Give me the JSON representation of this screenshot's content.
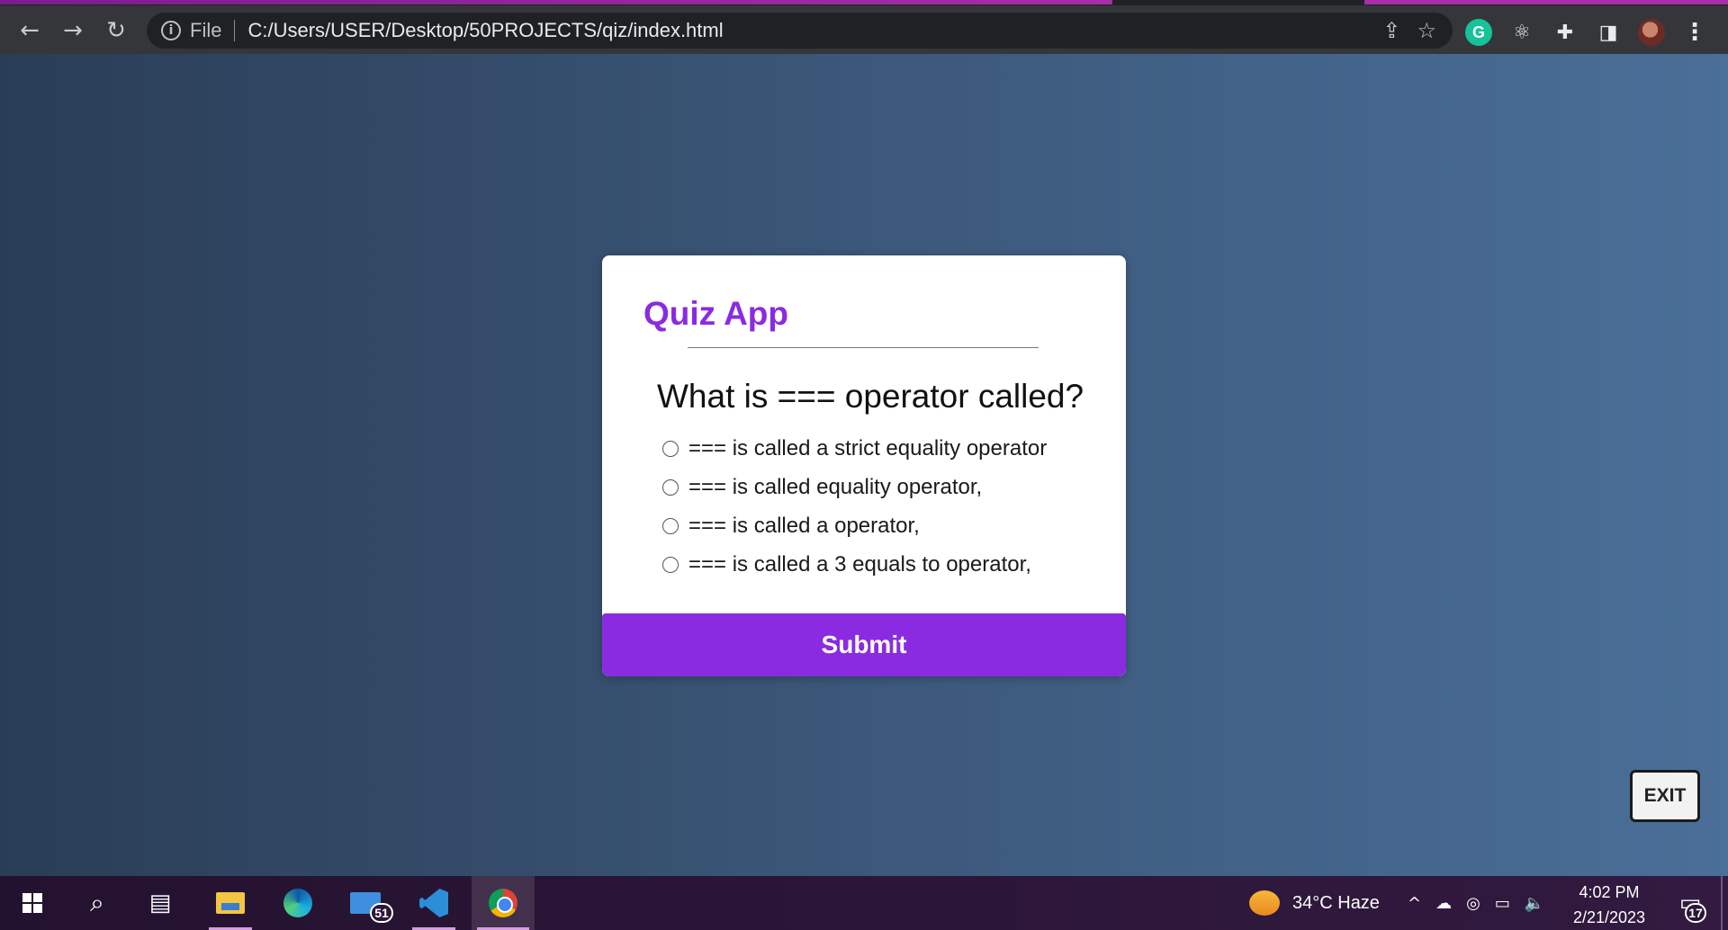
{
  "browser": {
    "back_icon": "←",
    "forward_icon": "→",
    "reload_icon": "↻",
    "info_icon": "i",
    "file_label": "File",
    "url": "C:/Users/USER/Desktop/50PROJECTS/qiz/index.html",
    "share_icon": "⇪",
    "star_icon": "☆",
    "extensions": {
      "grammarly_label": "G",
      "react_icon": "⚛",
      "puzzle_icon": "✚",
      "sidepanel_icon": "◨",
      "menu_icon": "⋮"
    }
  },
  "quiz": {
    "title": "Quiz App",
    "question": "What is === operator called?",
    "answers": [
      "=== is called a strict equality operator",
      "=== is called equality operator,",
      "=== is called a operator,",
      "=== is called a 3 equals to operator,"
    ],
    "submit_label": "Submit",
    "accent_color": "#8a2be2"
  },
  "exit_label": "EXIT",
  "taskbar": {
    "search_icon": "⌕",
    "taskview_icon": "▤",
    "mail_badge": "51",
    "weather": "34°C  Haze",
    "tray_chevron": "^",
    "tray_cloud": "☁",
    "tray_meet": "◎",
    "tray_battery": "▭",
    "tray_volume": "🔈",
    "time": "4:02 PM",
    "date": "2/21/2023",
    "notification_icon": "▭",
    "notification_count": "17"
  }
}
